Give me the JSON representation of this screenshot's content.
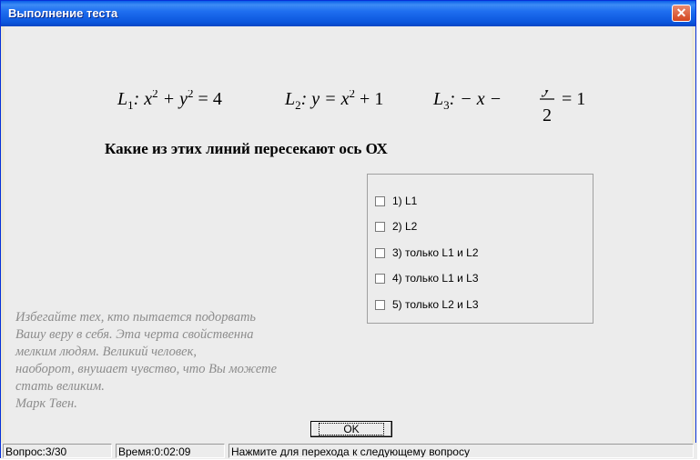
{
  "window": {
    "title": "Выполнение теста",
    "close_glyph": "✕"
  },
  "formula": {
    "l1_name": "L",
    "l1_sub": "1",
    "l1_expr_a": ": x",
    "l1_sup1": "2",
    "l1_expr_b": " + y",
    "l1_sup2": "2",
    "l1_expr_c": " = 4",
    "l2_name": "L",
    "l2_sub": "2",
    "l2_expr_a": ": y = x",
    "l2_sup": "2",
    "l2_expr_b": " + 1",
    "l3_name": "L",
    "l3_sub": "3",
    "l3_expr_a": ": − x −",
    "l3_num": "y",
    "l3_den": "2",
    "l3_expr_b": "= 1"
  },
  "question": "Какие из этих линий пересекают ось ОХ",
  "answers": [
    {
      "label": "1) L1",
      "checked": false
    },
    {
      "label": "2) L2",
      "checked": false
    },
    {
      "label": "3) только L1 и L2",
      "checked": false
    },
    {
      "label": "4) только L1 и L3",
      "checked": false
    },
    {
      "label": "5) только L2 и L3",
      "checked": false
    }
  ],
  "quote_lines": [
    "Избегайте тех, кто пытается подорвать",
    "Вашу веру в себя. Эта черта свойственна",
    "мелким людям. Великий человек,",
    "наоборот, внушает чувство, что Вы можете",
    "стать великим.",
    "Марк Твен."
  ],
  "ok_label": "OK",
  "status": {
    "question": "Вопрос:3/30",
    "time": "Время:0:02:09",
    "hint": "Нажмите для перехода к следующему вопросу"
  }
}
